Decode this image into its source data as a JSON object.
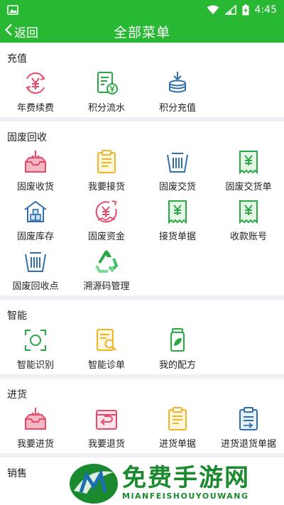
{
  "status": {
    "time": "4:45"
  },
  "header": {
    "back_label": "返回",
    "title": "全部菜单"
  },
  "sections": [
    {
      "title": "充值",
      "items": [
        {
          "label": "年费续费",
          "icon": "yen-cycle-icon"
        },
        {
          "label": "积分流水",
          "icon": "ledger-yen-icon"
        },
        {
          "label": "积分充值",
          "icon": "coins-download-icon"
        }
      ]
    },
    {
      "title": "固废回收",
      "items": [
        {
          "label": "固废收货",
          "icon": "inbox-download-icon"
        },
        {
          "label": "我要接货",
          "icon": "clipboard-icon"
        },
        {
          "label": "固废交货",
          "icon": "bin-icon"
        },
        {
          "label": "固废交货单",
          "icon": "receipt-yen-icon"
        },
        {
          "label": "固废库存",
          "icon": "warehouse-icon"
        },
        {
          "label": "固废资金",
          "icon": "yen-chart-icon"
        },
        {
          "label": "接货单据",
          "icon": "receipt-yen-icon"
        },
        {
          "label": "收款账号",
          "icon": "receipt-yen-icon"
        },
        {
          "label": "固废回收点",
          "icon": "bin-icon"
        },
        {
          "label": "溯源码管理",
          "icon": "recycle-icon"
        }
      ]
    },
    {
      "title": "智能",
      "items": [
        {
          "label": "智能识别",
          "icon": "scan-frame-icon"
        },
        {
          "label": "智能诊单",
          "icon": "doc-search-icon"
        },
        {
          "label": "我的配方",
          "icon": "jar-leaf-icon"
        }
      ]
    },
    {
      "title": "进货",
      "items": [
        {
          "label": "我要进货",
          "icon": "inbox-download-icon"
        },
        {
          "label": "我要退货",
          "icon": "box-return-icon"
        },
        {
          "label": "进货单据",
          "icon": "clipboard-icon"
        },
        {
          "label": "进货退货单据",
          "icon": "doc-return-icon"
        }
      ]
    },
    {
      "title": "销售",
      "items": []
    }
  ],
  "watermark": {
    "cn": "免费手游网",
    "en": "MIANFEISHOUYOUWANG"
  },
  "colors": {
    "primary": "#29b833",
    "pink": "#e94a6a",
    "green": "#2aa845",
    "blue": "#2f6fb0",
    "yellow": "#f0b429",
    "divider": "#eef0f5"
  }
}
